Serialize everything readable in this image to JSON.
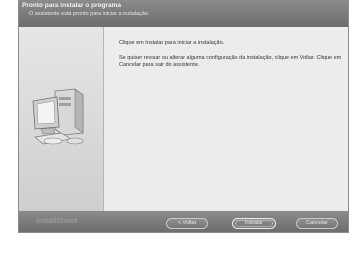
{
  "header": {
    "title": "Pronto para instalar o programa",
    "subtitle": "O assistente está pronto para iniciar a instalação."
  },
  "content": {
    "message_1": "Clique em Instalar para iniciar a instalação.",
    "message_2": "Se quiser revisar ou alterar alguma configuração da instalação, clique em Voltar. Clique em Cancelar para sair do assistente."
  },
  "footer": {
    "brand": "InstallShield",
    "back_label": "< Voltar",
    "install_label": "Instalar",
    "cancel_label": "Cancelar"
  },
  "left_pane": {
    "illustration": "computer-icon"
  },
  "colors": {
    "header_bg": "#7a7a7a",
    "footer_bg": "#7b7b7b",
    "content_bg": "#ececec"
  }
}
